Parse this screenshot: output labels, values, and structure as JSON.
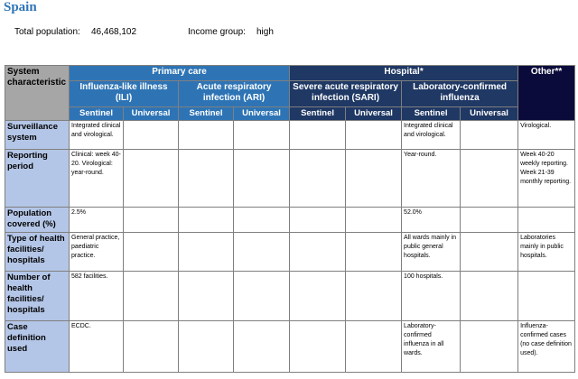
{
  "header": {
    "country": "Spain",
    "population_label": "Total population:",
    "population_value": "46,468,102",
    "income_label": "Income group:",
    "income_value": "high"
  },
  "table": {
    "characteristic_header": "System characteristic",
    "groups": {
      "primary": "Primary care",
      "hospital": "Hospital*",
      "other": "Other**"
    },
    "subgroups": {
      "ili": "Influenza-like illness (ILI)",
      "ari": "Acute respiratory infection (ARI)",
      "sari": "Severe acute respiratory infection (SARI)",
      "lab": "Laboratory-confirmed influenza"
    },
    "leaf": {
      "sentinel": "Sentinel",
      "universal": "Universal"
    },
    "rows": [
      {
        "label": "Surveillance system",
        "cells": [
          "Integrated clinical and virological.",
          "",
          "",
          "",
          "",
          "",
          "Integrated clinical and virological.",
          "",
          "Virological."
        ]
      },
      {
        "label": "Reporting period",
        "cells": [
          "Clinical: week 40-20. Virological: year-round.",
          "",
          "",
          "",
          "",
          "",
          "Year-round.",
          "",
          "Week 40-20 weekly reporting. Week 21-39 monthly reporting."
        ]
      },
      {
        "label": "Population covered (%)",
        "cells": [
          "2.5%",
          "",
          "",
          "",
          "",
          "",
          "52.0%",
          "",
          ""
        ]
      },
      {
        "label": "Type of health facilities/ hospitals",
        "cells": [
          "General practice, paediatric practice.",
          "",
          "",
          "",
          "",
          "",
          "All wards mainly in public general hospitals.",
          "",
          "Laboratories mainly in public hospitals."
        ]
      },
      {
        "label": "Number of health facilities/ hospitals",
        "cells": [
          "582 facilities.",
          "",
          "",
          "",
          "",
          "",
          "100 hospitals.",
          "",
          ""
        ]
      },
      {
        "label": "Case definition used",
        "cells": [
          "ECDC.",
          "",
          "",
          "",
          "",
          "",
          "Laboratory-confirmed influenza in all wards.",
          "",
          "Influenza-confirmed cases (no case definition used)."
        ]
      }
    ]
  }
}
